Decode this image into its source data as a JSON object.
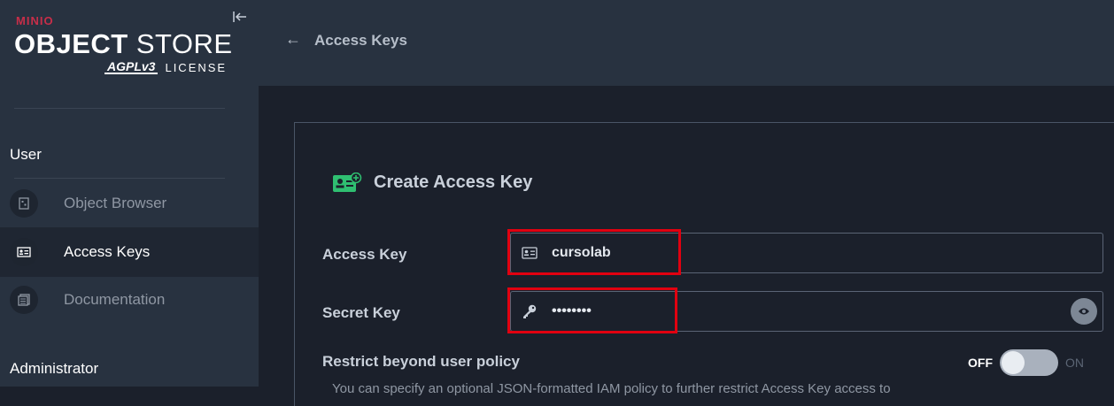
{
  "brand": {
    "minio": "MINIO",
    "title_bold": "OBJECT",
    "title_rest": " STORE",
    "agpl": "AGPLv3",
    "license": "LICENSE"
  },
  "sidebar": {
    "user_section": "User",
    "admin_section": "Administrator",
    "items": [
      {
        "label": "Object Browser",
        "icon": "bucket-icon",
        "active": false
      },
      {
        "label": "Access Keys",
        "icon": "id-card-icon",
        "active": true
      },
      {
        "label": "Documentation",
        "icon": "documentation-icon",
        "active": false
      }
    ]
  },
  "header": {
    "back_symbol": "←",
    "title": "Access Keys"
  },
  "form": {
    "title": "Create Access Key",
    "access_key": {
      "label": "Access Key",
      "value": "cursolab"
    },
    "secret_key": {
      "label": "Secret Key",
      "value": "••••••••"
    },
    "restrict": {
      "label": "Restrict beyond user policy",
      "off_label": "OFF",
      "on_label": "ON",
      "state": "off"
    },
    "helper_text": "You can specify an optional JSON-formatted IAM policy to further restrict Access Key access to"
  },
  "colors": {
    "accent_green": "#2fbf71",
    "highlight_red": "#e10010",
    "brand_red": "#c72e49"
  }
}
